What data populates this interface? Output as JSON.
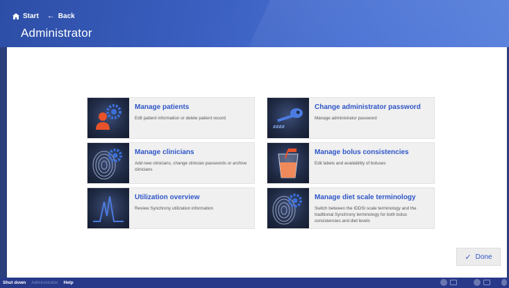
{
  "nav": {
    "start_label": "Start",
    "back_label": "Back"
  },
  "header": {
    "title": "Administrator"
  },
  "cards": [
    {
      "title": "Manage patients",
      "description": "Edit patient information or delete patient record",
      "icon": "patient-gear-icon"
    },
    {
      "title": "Change administrator password",
      "description": "Manage administrator password",
      "icon": "key-icon"
    },
    {
      "title": "Manage clinicians",
      "description": "Add new clinicians, change clinician passwords or archive clinicians",
      "icon": "fingerprint-gear-icon"
    },
    {
      "title": "Manage bolus consistencies",
      "description": "Edit labels and availability of boluses",
      "icon": "glass-icon"
    },
    {
      "title": "Utilization overview",
      "description": "Review Synchrony utilization information",
      "icon": "waveform-icon"
    },
    {
      "title": "Manage diet scale terminology",
      "description": "Switch between the IDDSI scale terminology and the traditional Synchrony terminology for both bolus consistencies and diet levels",
      "icon": "fingerprint-gear-icon"
    }
  ],
  "done_label": "Done",
  "footer": {
    "shutdown": "Shut down",
    "role": "Administrator",
    "help": "Help"
  },
  "colors": {
    "accent": "#2f56c8",
    "header": "#3a5fc0",
    "footer": "#28398a",
    "person": "#e8522a",
    "gear": "#3a6fd8"
  }
}
